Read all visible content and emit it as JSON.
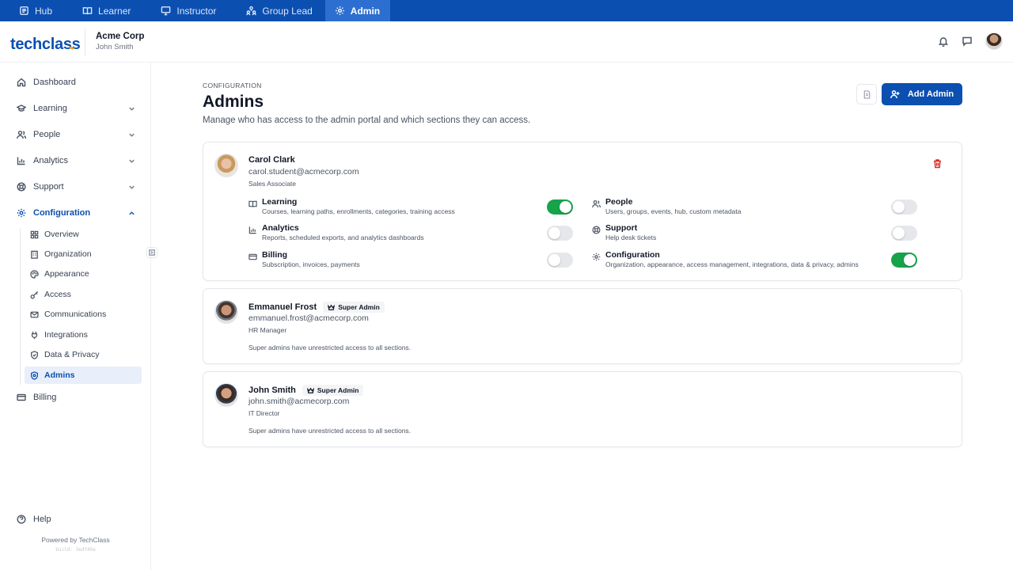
{
  "topbar": {
    "tabs": [
      {
        "label": "Hub",
        "icon": "hub-icon",
        "active": false
      },
      {
        "label": "Learner",
        "icon": "book-icon",
        "active": false
      },
      {
        "label": "Instructor",
        "icon": "monitor-icon",
        "active": false
      },
      {
        "label": "Group Lead",
        "icon": "group-icon",
        "active": false
      },
      {
        "label": "Admin",
        "icon": "gear-icon",
        "active": true
      }
    ]
  },
  "header": {
    "logo_text": "techclass",
    "org_name": "Acme Corp",
    "user_name": "John Smith"
  },
  "sidebar": {
    "items": [
      {
        "label": "Dashboard",
        "icon": "home-icon"
      },
      {
        "label": "Learning",
        "icon": "graduation-cap-icon"
      },
      {
        "label": "People",
        "icon": "users-icon"
      },
      {
        "label": "Analytics",
        "icon": "bar-chart-icon"
      },
      {
        "label": "Support",
        "icon": "lifebuoy-icon"
      },
      {
        "label": "Configuration",
        "icon": "gear-icon"
      },
      {
        "label": "Billing",
        "icon": "credit-card-icon"
      }
    ],
    "config_sub": [
      {
        "label": "Overview",
        "icon": "grid-icon"
      },
      {
        "label": "Organization",
        "icon": "building-icon"
      },
      {
        "label": "Appearance",
        "icon": "palette-icon"
      },
      {
        "label": "Access",
        "icon": "key-icon"
      },
      {
        "label": "Communications",
        "icon": "mail-icon"
      },
      {
        "label": "Integrations",
        "icon": "plug-icon"
      },
      {
        "label": "Data & Privacy",
        "icon": "shield-icon"
      },
      {
        "label": "Admins",
        "icon": "admin-gear-icon"
      }
    ],
    "help_label": "Help",
    "powered_by": "Powered by TechClass",
    "build": "build: 3edf40a"
  },
  "main": {
    "eyebrow": "CONFIGURATION",
    "title": "Admins",
    "description": "Manage who has access to the admin portal and which sections they can access.",
    "add_button_label": "Add Admin"
  },
  "admins": [
    {
      "name": "Carol Clark",
      "email": "carol.student@acmecorp.com",
      "role": "Sales Associate",
      "super_admin": false,
      "permissions": [
        {
          "title": "Learning",
          "desc": "Courses, learning paths, enrollments, categories, training access",
          "icon": "book-icon",
          "enabled": true
        },
        {
          "title": "People",
          "desc": "Users, groups, events, hub, custom metadata",
          "icon": "users-icon",
          "enabled": false
        },
        {
          "title": "Analytics",
          "desc": "Reports, scheduled exports, and analytics dashboards",
          "icon": "bar-chart-icon",
          "enabled": false
        },
        {
          "title": "Support",
          "desc": "Help desk tickets",
          "icon": "lifebuoy-icon",
          "enabled": false
        },
        {
          "title": "Billing",
          "desc": "Subscription, invoices, payments",
          "icon": "credit-card-icon",
          "enabled": false
        },
        {
          "title": "Configuration",
          "desc": "Organization, appearance, access management, integrations, data & privacy, admins",
          "icon": "gear-icon",
          "enabled": true
        }
      ]
    },
    {
      "name": "Emmanuel Frost",
      "email": "emmanuel.frost@acmecorp.com",
      "role": "HR Manager",
      "super_admin": true,
      "badge": "Super Admin",
      "note": "Super admins have unrestricted access to all sections."
    },
    {
      "name": "John Smith",
      "email": "john.smith@acmecorp.com",
      "role": "IT Director",
      "super_admin": true,
      "badge": "Super Admin",
      "note": "Super admins have unrestricted access to all sections."
    }
  ],
  "colors": {
    "brand": "#0b4fb1",
    "toggle_on": "#16a34a",
    "danger": "#dc2626"
  }
}
